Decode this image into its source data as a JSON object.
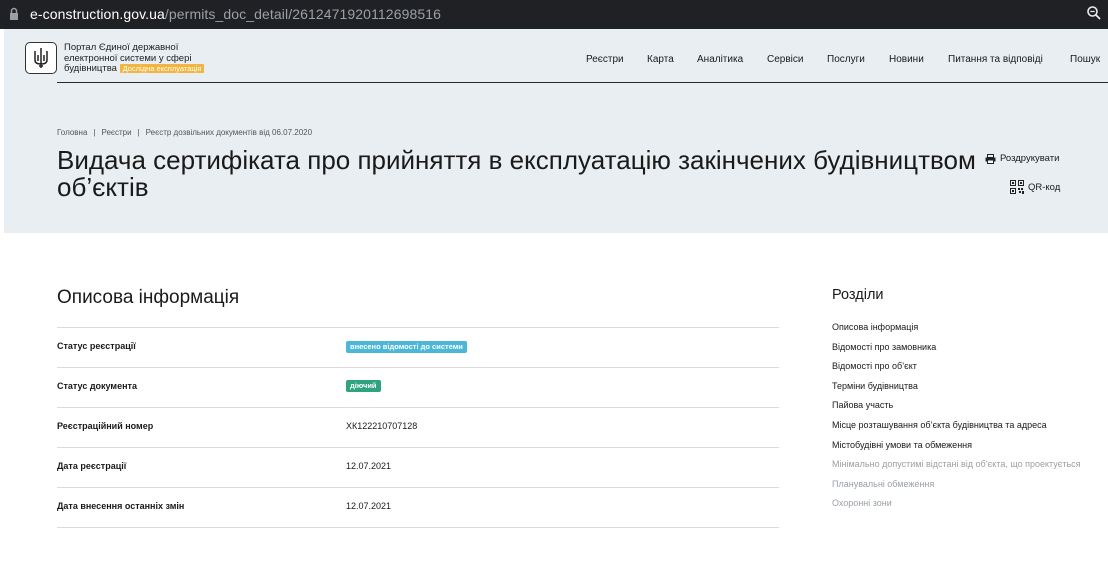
{
  "browser": {
    "url_host": "e-construction.gov.ua",
    "url_path": "/permits_doc_detail/2612471920112698516"
  },
  "header": {
    "portal_name": "Портал Єдиної державної електронної системи у сфері будівництва",
    "beta_label": "Дослідна експлуатація",
    "nav": [
      "Реєстри",
      "Карта",
      "Аналітика",
      "Сервіси",
      "Послуги",
      "Новини",
      "Питання та відповіді",
      "Пошук"
    ]
  },
  "breadcrumb": [
    "Головна",
    "Реєстри",
    "Реєстр дозвільних документів від 06.07.2020"
  ],
  "page_title": "Видача сертифіката про прийняття в експлуатацію закінчених будівництвом об’єктів",
  "actions": {
    "print": "Роздрукувати",
    "qr": "QR-код"
  },
  "main": {
    "section_title": "Описова інформація",
    "rows": [
      {
        "label": "Статус реєстрації",
        "value": "внесено відомості до системи",
        "kind": "badge-blue"
      },
      {
        "label": "Статус документа",
        "value": "діючий",
        "kind": "badge-green"
      },
      {
        "label": "Реєстраційний номер",
        "value": "ХК122210707128",
        "kind": "text"
      },
      {
        "label": "Дата реєстрації",
        "value": "12.07.2021",
        "kind": "text"
      },
      {
        "label": "Дата внесення останніх змін",
        "value": "12.07.2021",
        "kind": "text"
      }
    ]
  },
  "sidebar": {
    "title": "Розділи",
    "items": [
      {
        "label": "Описова інформація",
        "muted": false
      },
      {
        "label": "Відомості про замовника",
        "muted": false
      },
      {
        "label": "Відомості про об’єкт",
        "muted": false
      },
      {
        "label": "Терміни будівництва",
        "muted": false
      },
      {
        "label": "Пайова участь",
        "muted": false
      },
      {
        "label": "Місце розташування об’єкта будівництва та адреса",
        "muted": false
      },
      {
        "label": "Містобудівні умови та обмеження",
        "muted": false
      },
      {
        "label": "Мінімально допустимі відстані від об’єкта, що проектується",
        "muted": true
      },
      {
        "label": "Планувальні обмеження",
        "muted": true
      },
      {
        "label": "Охоронні зони",
        "muted": true
      }
    ]
  },
  "colors": {
    "badge_blue": "#4cb7d6",
    "badge_green": "#2fa37f",
    "beta": "#f2b53f",
    "hero_bg": "#e9eef2"
  }
}
